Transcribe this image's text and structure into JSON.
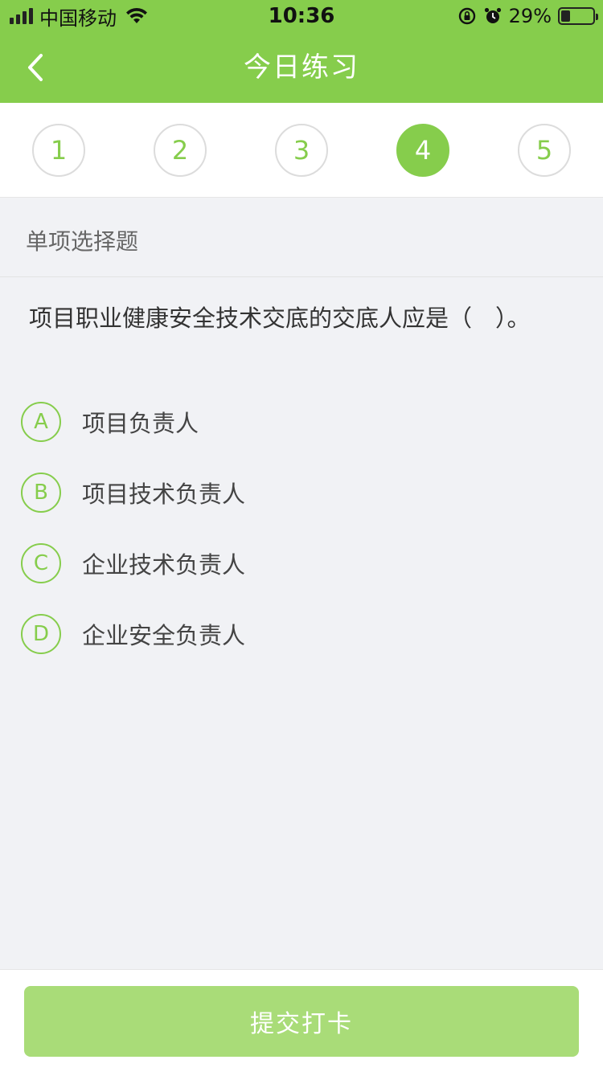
{
  "status_bar": {
    "carrier": "中国移动",
    "time": "10:36",
    "battery_percent": "29%",
    "battery_level": 0.29
  },
  "nav": {
    "back_icon": "chevron-left-icon",
    "title": "今日练习"
  },
  "steps": {
    "items": [
      "1",
      "2",
      "3",
      "4",
      "5"
    ],
    "active_index": 3
  },
  "question": {
    "type": "单项选择题",
    "text": "项目职业健康安全技术交底的交底人应是（　）。",
    "options": [
      {
        "letter": "A",
        "text": "项目负责人"
      },
      {
        "letter": "B",
        "text": "项目技术负责人"
      },
      {
        "letter": "C",
        "text": "企业技术负责人"
      },
      {
        "letter": "D",
        "text": "企业安全负责人"
      }
    ]
  },
  "footer": {
    "submit_label": "提交打卡"
  },
  "colors": {
    "brand": "#86cd4c",
    "submit_disabled": "#a9dc78",
    "background": "#f1f2f5"
  }
}
